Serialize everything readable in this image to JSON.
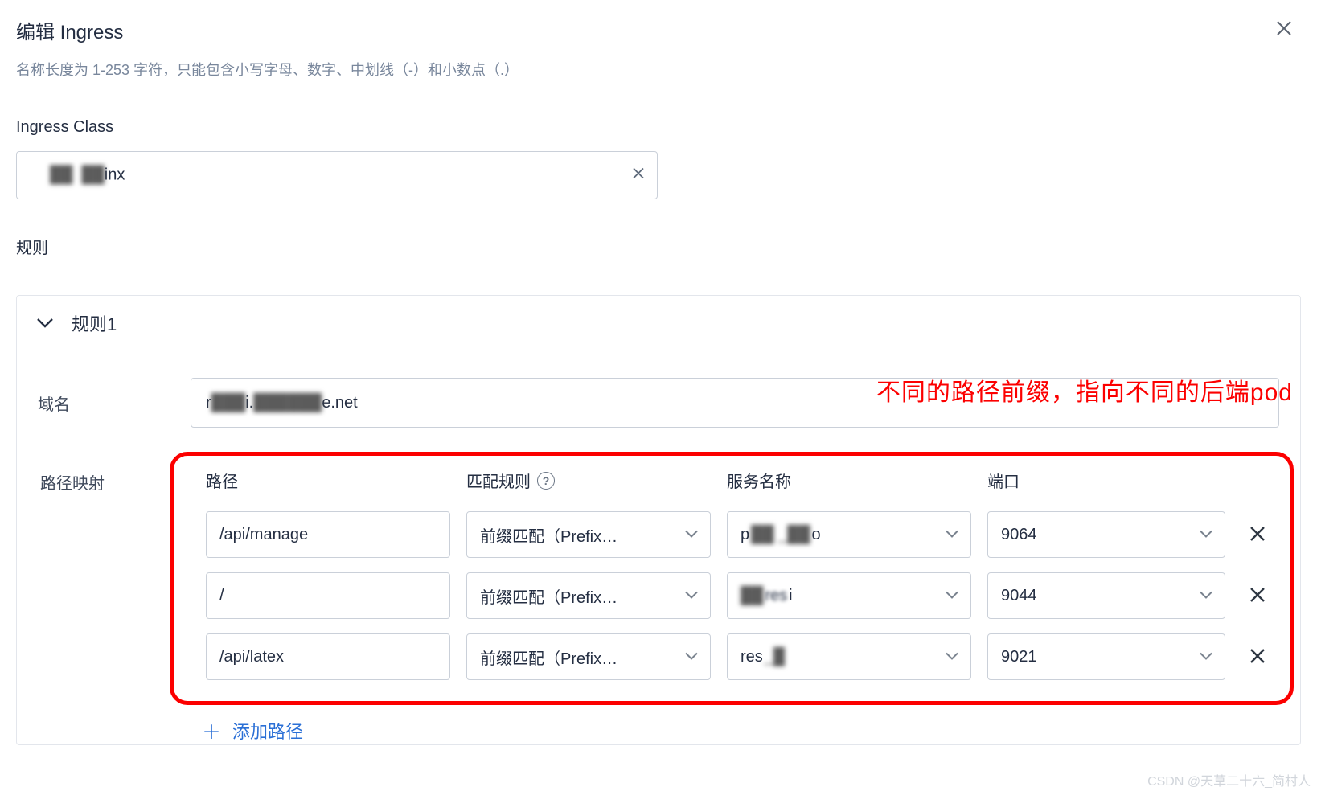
{
  "header": {
    "title": "编辑 Ingress"
  },
  "hint": "名称长度为 1-253 字符，只能包含小写字母、数字、中划线（-）和小数点（.）",
  "ingressClass": {
    "label": "Ingress Class",
    "prefix": "n",
    "suffix": "inx"
  },
  "rules": {
    "label": "规则",
    "ruleTitle": "规则1",
    "domain": {
      "label": "域名",
      "p1": "r",
      "p2": "i.",
      "p3": "e.net"
    },
    "annotation": "不同的路径前缀，指向不同的后端pod",
    "mapping": {
      "label": "路径映射",
      "cols": {
        "path": "路径",
        "match": "匹配规则",
        "service": "服务名称",
        "port": "端口"
      },
      "matchValue": "前缀匹配（Prefix…",
      "rows": [
        {
          "path": "/api/manage",
          "svcPre": "p",
          "svcSuf": "o",
          "port": "9064"
        },
        {
          "path": "/",
          "svcPre": "res",
          "svcSuf": "i",
          "port": "9044"
        },
        {
          "path": "/api/latex",
          "svcPre": "res",
          "svcSuf": "",
          "port": "9021"
        }
      ],
      "addLabel": "添加路径"
    }
  },
  "watermark": "CSDN @天草二十六_简村人"
}
